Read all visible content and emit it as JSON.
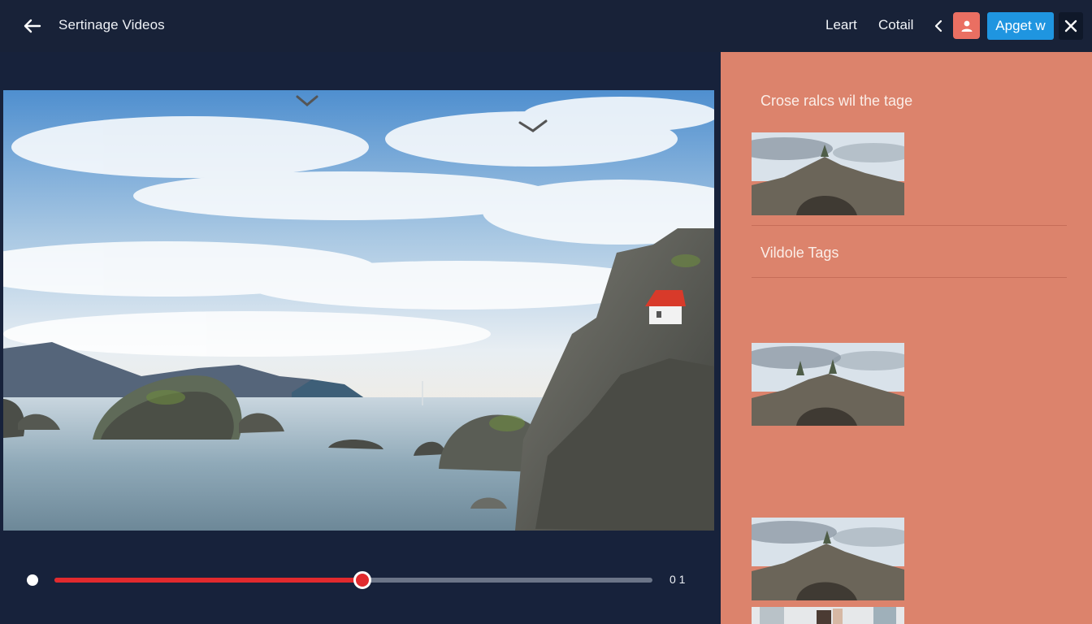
{
  "header": {
    "title": "Sertinage Videos",
    "nav_links": [
      "Leart",
      "Cotail"
    ],
    "primary_button_label": "Apget w",
    "icons": {
      "back": "arrow-left-icon",
      "chevron": "chevron-left-icon",
      "avatar": "user-icon",
      "close": "close-icon"
    }
  },
  "player": {
    "progress_percent": 51.5,
    "time_label": "0 1"
  },
  "sidebar": {
    "heading_1": "Crose ralcs wil the tage",
    "heading_2": "Vildole Tags"
  },
  "colors": {
    "background": "#17223b",
    "sidebar": "#dc836c",
    "accent_red": "#e12a2e",
    "primary_blue": "#1f95e0",
    "avatar_coral": "#ea6f62"
  }
}
